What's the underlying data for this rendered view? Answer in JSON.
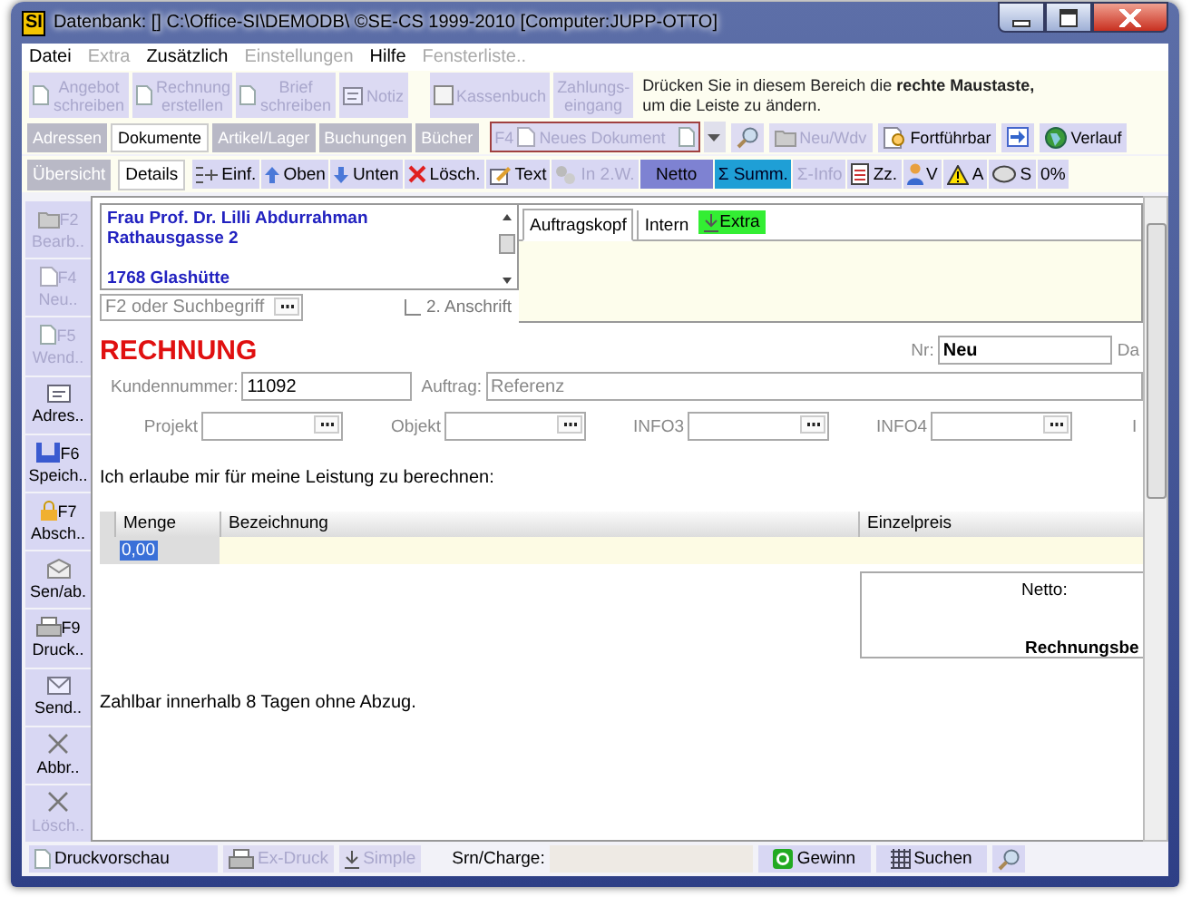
{
  "window": {
    "logo": "SI",
    "title": "Datenbank: [] C:\\Office-SI\\DEMODB\\ ©SE-CS 1999-2010 [Computer:JUPP-OTTO]"
  },
  "menu": [
    {
      "label": "Datei",
      "disabled": false
    },
    {
      "label": "Extra",
      "disabled": true
    },
    {
      "label": "Zusätzlich",
      "disabled": false
    },
    {
      "label": "Einstellungen",
      "disabled": true
    },
    {
      "label": "Hilfe",
      "disabled": false
    },
    {
      "label": "Fensterliste..",
      "disabled": true
    }
  ],
  "toolbar": {
    "buttons": [
      {
        "label": "Angebot schreiben",
        "disabled": true
      },
      {
        "label": "Rechnung erstellen",
        "disabled": true
      },
      {
        "label": "Brief schreiben",
        "disabled": true
      },
      {
        "label": "Notiz",
        "disabled": true
      },
      {
        "label": "Kassenbuch",
        "disabled": true
      },
      {
        "label": "Zahlungs-eingang",
        "disabled": true
      }
    ],
    "hint": "Drücken Sie in diesem Bereich die **rechte Maustaste,** um die Leiste zu ändern."
  },
  "tabs": [
    {
      "label": "Adressen",
      "selected": false
    },
    {
      "label": "Dokumente",
      "selected": true
    },
    {
      "label": "Artikel/Lager",
      "selected": false
    },
    {
      "label": "Buchungen",
      "selected": false
    },
    {
      "label": "Bücher",
      "selected": false
    }
  ],
  "document_bar": {
    "key": "F4",
    "value": "Neues Dokument",
    "buttons": [
      {
        "label": "Neu/Wdv",
        "disabled": true
      },
      {
        "label": "Fortführbar",
        "disabled": false
      },
      {
        "label": "Verlauf",
        "disabled": false
      }
    ]
  },
  "view_tabs": [
    {
      "label": "Übersicht",
      "selected": false
    },
    {
      "label": "Details",
      "selected": true
    }
  ],
  "tools": [
    {
      "label": "Einf.",
      "disabled": false,
      "pressed": false,
      "highlighted": false
    },
    {
      "label": "Oben",
      "disabled": false,
      "pressed": false,
      "highlighted": false
    },
    {
      "label": "Unten",
      "disabled": false,
      "pressed": false,
      "highlighted": false
    },
    {
      "label": "Lösch.",
      "disabled": false,
      "pressed": false,
      "highlighted": false
    },
    {
      "label": "Text",
      "disabled": false,
      "pressed": false,
      "highlighted": false
    },
    {
      "label": "In 2.W.",
      "disabled": true,
      "pressed": false,
      "highlighted": false
    },
    {
      "label": "Netto",
      "disabled": false,
      "pressed": true,
      "highlighted": false
    },
    {
      "label": "Σ Summ.",
      "disabled": false,
      "pressed": false,
      "highlighted": true
    },
    {
      "label": "Σ-Info",
      "disabled": true,
      "pressed": false,
      "highlighted": false
    },
    {
      "label": "Zz.",
      "disabled": false,
      "pressed": false,
      "highlighted": false
    },
    {
      "label": "V",
      "disabled": false,
      "pressed": false,
      "highlighted": false
    },
    {
      "label": "A",
      "disabled": false,
      "pressed": false,
      "highlighted": false
    },
    {
      "label": "S",
      "disabled": false,
      "pressed": false,
      "highlighted": false
    },
    {
      "label": "0%",
      "disabled": false,
      "pressed": false,
      "highlighted": false
    }
  ],
  "sidebar": [
    {
      "key": "F2",
      "label": "Bearb..",
      "disabled": true
    },
    {
      "key": "F4",
      "label": "Neu..",
      "disabled": true
    },
    {
      "key": "F5",
      "label": "Wend..",
      "disabled": true
    },
    {
      "label": "Adres..",
      "disabled": false
    },
    {
      "key": "F6",
      "label": "Speich..",
      "disabled": false
    },
    {
      "key": "F7",
      "label": "Absch..",
      "disabled": false
    },
    {
      "label": "Sen/ab.",
      "disabled": false
    },
    {
      "key": "F9",
      "label": "Druck..",
      "disabled": false
    },
    {
      "label": "Send..",
      "disabled": false
    },
    {
      "label": "Abbr..",
      "disabled": false
    },
    {
      "label": "Lösch..",
      "disabled": true
    }
  ],
  "document": {
    "address": [
      "Frau Prof. Dr. Lilli Abdurrahman",
      "Rathausgasse 2"
    ],
    "city": "1768 Glashütte",
    "search": {
      "placeholder": "F2 oder Suchbegriff"
    },
    "second_address": {
      "label": "2. Anschrift",
      "checked": false
    },
    "header_tabs": [
      {
        "label": "Auftragskopf",
        "selected": true,
        "kind": "plain"
      },
      {
        "label": "Intern",
        "selected": false,
        "kind": "plain"
      },
      {
        "label": "Extra",
        "selected": false,
        "kind": "extra"
      }
    ],
    "title": "RECHNUNG",
    "number": {
      "label": "Nr:",
      "value": "Neu"
    },
    "date_label": "Da",
    "customer": {
      "label": "Kundennummer:",
      "value": "11092"
    },
    "order": {
      "label": "Auftrag:",
      "placeholder": "Referenz"
    },
    "info_fields": [
      "Projekt",
      "Objekt",
      "INFO3",
      "INFO4"
    ],
    "next_label": "I",
    "intro": "Ich erlaube mir für meine Leistung zu berechnen:",
    "table": {
      "columns": [
        "Menge",
        "Bezeichnung",
        "Einzelpreis"
      ],
      "rows": [
        {
          "quantity": "0,00",
          "selected": true
        }
      ]
    },
    "totals": {
      "net_label": "Netto:",
      "gross_label": "Rechnungsbe"
    },
    "footer": "Zahlbar innerhalb 8 Tagen ohne Abzug."
  },
  "status_bar": {
    "buttons": [
      {
        "label": "Druckvorschau",
        "disabled": false
      },
      {
        "label": "Ex-Druck",
        "disabled": true
      },
      {
        "label": "Simple",
        "disabled": true
      }
    ],
    "serial_label": "Srn/Charge:",
    "right_buttons": [
      {
        "label": "Gewinn",
        "disabled": false
      },
      {
        "label": "Suchen",
        "disabled": false
      }
    ]
  }
}
